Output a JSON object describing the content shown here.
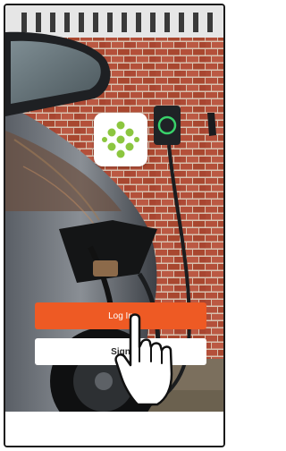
{
  "colors": {
    "accent": "#ee5a24",
    "logo_green": "#8cc63f",
    "charger_ring": "#39d26a",
    "brick": "#b5523d",
    "mortar": "#d9c3b3"
  },
  "logo": {
    "icon": "leaf-dots-logo"
  },
  "actions": {
    "login_label": "Log In",
    "signup_label": "Sign"
  },
  "overlay": {
    "icon": "pointing-hand-icon"
  }
}
